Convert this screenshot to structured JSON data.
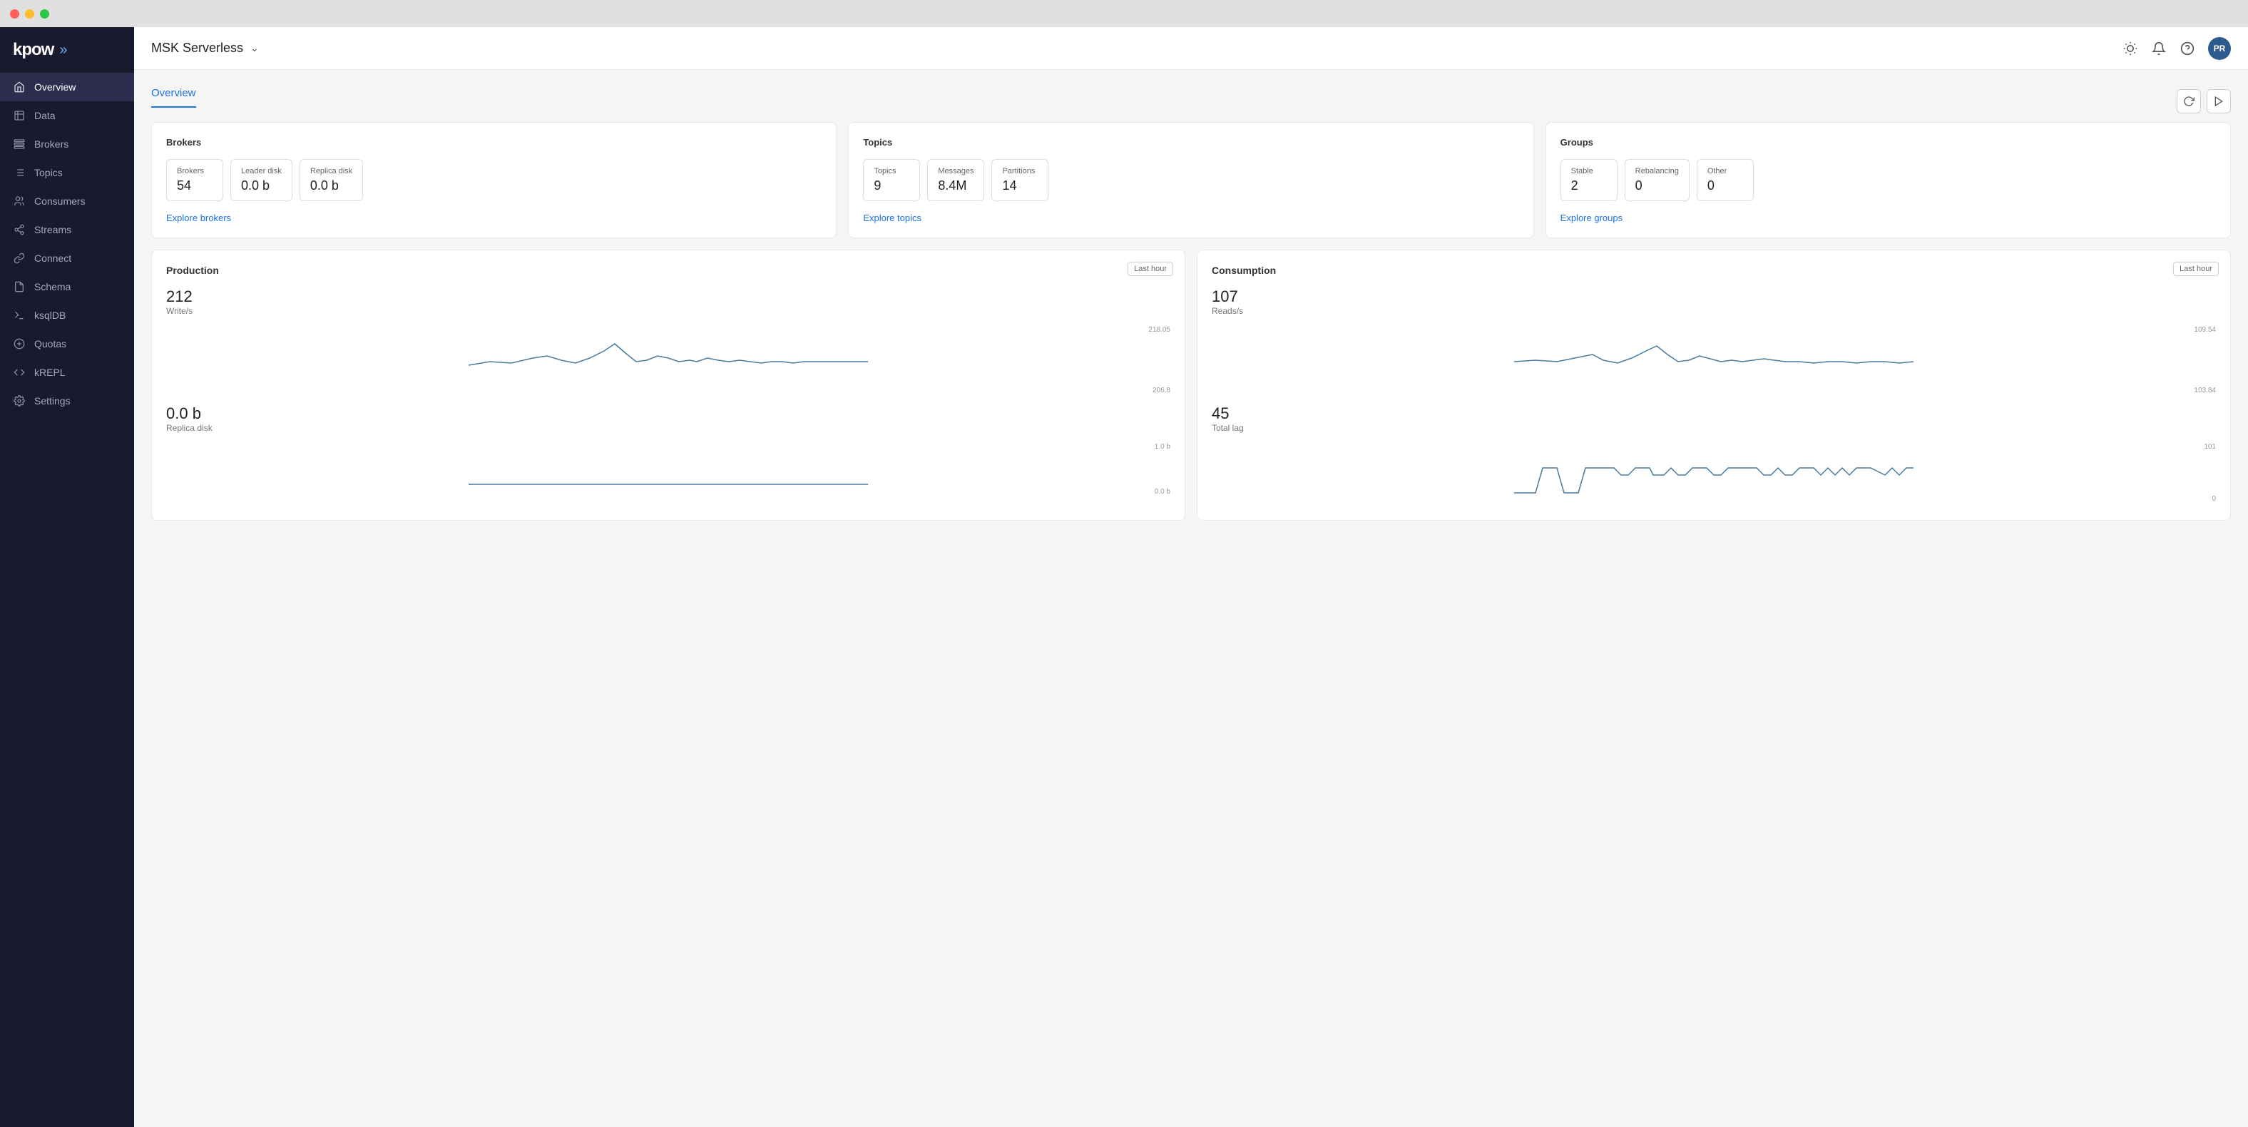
{
  "titlebar": {
    "buttons": [
      "red",
      "yellow",
      "green"
    ]
  },
  "sidebar": {
    "logo": "kpow",
    "logo_arrows": "»",
    "items": [
      {
        "id": "overview",
        "label": "Overview",
        "icon": "home",
        "active": true
      },
      {
        "id": "data",
        "label": "Data",
        "icon": "database"
      },
      {
        "id": "brokers",
        "label": "Brokers",
        "icon": "server"
      },
      {
        "id": "topics",
        "label": "Topics",
        "icon": "list"
      },
      {
        "id": "consumers",
        "label": "Consumers",
        "icon": "users"
      },
      {
        "id": "streams",
        "label": "Streams",
        "icon": "share"
      },
      {
        "id": "connect",
        "label": "Connect",
        "icon": "plug"
      },
      {
        "id": "schema",
        "label": "Schema",
        "icon": "file"
      },
      {
        "id": "ksqldb",
        "label": "ksqlDB",
        "icon": "terminal"
      },
      {
        "id": "quotas",
        "label": "Quotas",
        "icon": "gauge"
      },
      {
        "id": "krepl",
        "label": "kREPL",
        "icon": "code"
      },
      {
        "id": "settings",
        "label": "Settings",
        "icon": "gear"
      }
    ]
  },
  "header": {
    "title": "MSK Serverless",
    "user_initials": "PR"
  },
  "overview": {
    "tab_label": "Overview",
    "brokers_card": {
      "title": "Brokers",
      "stats": [
        {
          "label": "Brokers",
          "value": "54"
        },
        {
          "label": "Leader disk",
          "value": "0.0 b"
        },
        {
          "label": "Replica disk",
          "value": "0.0 b"
        }
      ],
      "explore_link": "Explore brokers"
    },
    "topics_card": {
      "title": "Topics",
      "stats": [
        {
          "label": "Topics",
          "value": "9"
        },
        {
          "label": "Messages",
          "value": "8.4M"
        },
        {
          "label": "Partitions",
          "value": "14"
        }
      ],
      "explore_link": "Explore topics"
    },
    "groups_card": {
      "title": "Groups",
      "stats": [
        {
          "label": "Stable",
          "value": "2"
        },
        {
          "label": "Rebalancing",
          "value": "0"
        },
        {
          "label": "Other",
          "value": "0"
        }
      ],
      "explore_link": "Explore groups"
    },
    "production_chart": {
      "title": "Production",
      "time_label": "Last hour",
      "write_value": "212",
      "write_label": "Write/s",
      "replica_value": "0.0 b",
      "replica_label": "Replica disk",
      "y_max_writes": "218.05",
      "y_min_writes": "206.8",
      "y_max_replica": "1.0 b",
      "y_min_replica": "0.0 b"
    },
    "consumption_chart": {
      "title": "Consumption",
      "time_label": "Last hour",
      "reads_value": "107",
      "reads_label": "Reads/s",
      "lag_value": "45",
      "lag_label": "Total lag",
      "y_max_reads": "109.54",
      "y_min_reads": "103.84",
      "y_max_lag": "101",
      "y_min_lag": "0"
    }
  }
}
